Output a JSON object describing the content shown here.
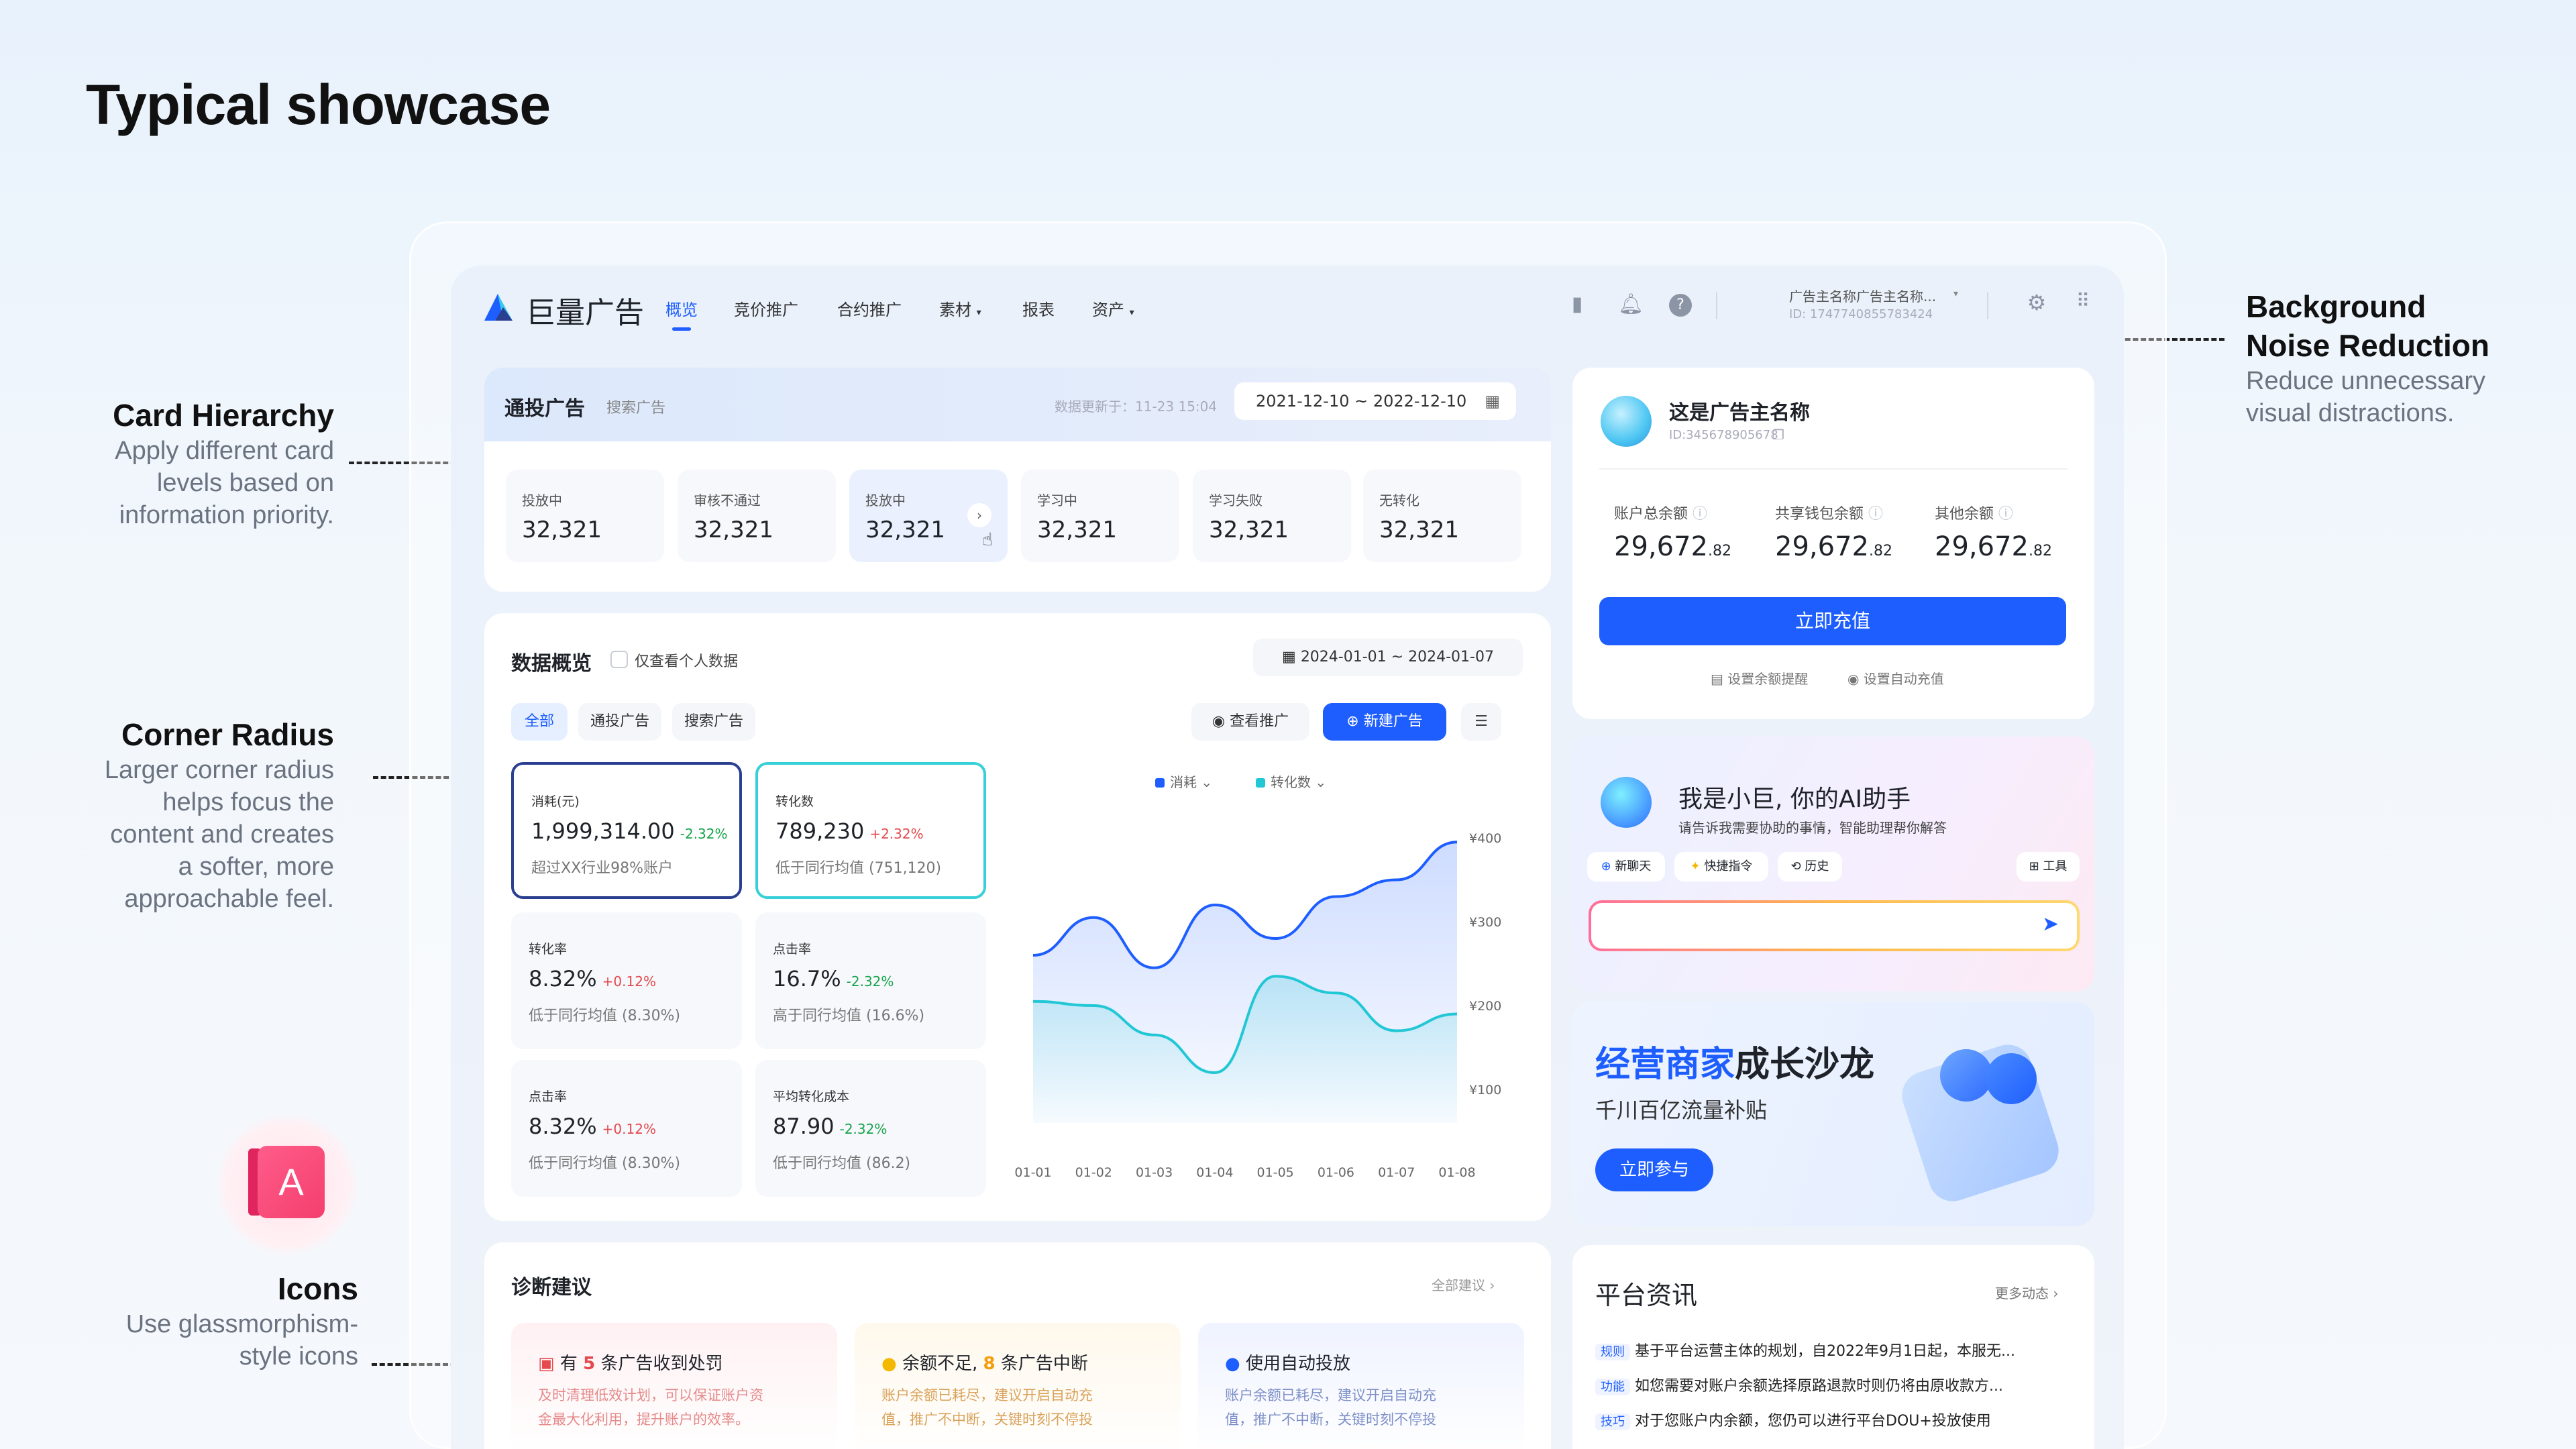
{
  "showcase": {
    "title": "Typical showcase",
    "annotations": [
      {
        "title": "Card Hierarchy",
        "desc": [
          "Apply different card",
          "levels based on",
          "information priority."
        ]
      },
      {
        "title": "Corner Radius",
        "desc": [
          "Larger corner radius",
          "helps focus the",
          "content and creates",
          "a softer, more",
          "approachable feel."
        ]
      },
      {
        "title": "Icons",
        "desc": [
          "Use glassmorphism-",
          "style icons"
        ]
      },
      {
        "title": "Background",
        "title2": "Noise Reduction",
        "desc": [
          "Reduce unnecessary",
          "visual distractions."
        ]
      }
    ]
  },
  "nav": {
    "brand": "巨量广告",
    "items": [
      "概览",
      "竞价推广",
      "合约推广",
      "素材",
      "报表",
      "资产"
    ],
    "account_name": "广告主名称广告主名称...",
    "account_id": "ID: 1747740855783424"
  },
  "topcard": {
    "tab_main": "通投广告",
    "tab_sub": "搜索广告",
    "updated": "数据更新于：11-23 15:04",
    "date_range": "2021-12-10 ~ 2022-12-10",
    "stats": [
      {
        "label": "投放中",
        "value": "32,321"
      },
      {
        "label": "审核不通过",
        "value": "32,321"
      },
      {
        "label": "投放中",
        "value": "32,321"
      },
      {
        "label": "学习中",
        "value": "32,321"
      },
      {
        "label": "学习失败",
        "value": "32,321"
      },
      {
        "label": "无转化",
        "value": "32,321"
      }
    ]
  },
  "overview": {
    "title": "数据概览",
    "only_mine": "仅查看个人数据",
    "date_range": "2024-01-01 ~ 2024-01-07",
    "filters": [
      "全部",
      "通投广告",
      "搜索广告"
    ],
    "view_btn": "查看推广",
    "new_btn": "新建广告",
    "metrics": [
      {
        "label": "消耗(元)",
        "value": "1,999,314.00",
        "delta": "-2.32%",
        "dir": "dn",
        "sub": "超过XX行业98%账户"
      },
      {
        "label": "转化数",
        "value": "789,230",
        "delta": "+2.32%",
        "dir": "up",
        "sub": "低于同行均值 (751,120)"
      },
      {
        "label": "转化率",
        "value": "8.32%",
        "delta": "+0.12%",
        "dir": "up",
        "sub": "低于同行均值 (8.30%)"
      },
      {
        "label": "点击率",
        "value": "16.7%",
        "delta": "-2.32%",
        "dir": "dn",
        "sub": "高于同行均值 (16.6%)"
      },
      {
        "label": "点击率",
        "value": "8.32%",
        "delta": "+0.12%",
        "dir": "up",
        "sub": "低于同行均值 (8.30%)"
      },
      {
        "label": "平均转化成本",
        "value": "87.90",
        "delta": "-2.32%",
        "dir": "dn",
        "sub": "低于同行均值 (86.2)"
      }
    ]
  },
  "chart_data": {
    "type": "area",
    "x": [
      "01-01",
      "01-02",
      "01-03",
      "01-04",
      "01-05",
      "01-06",
      "01-07",
      "01-08"
    ],
    "yticks": [
      "¥400",
      "¥300",
      "¥200",
      "¥100"
    ],
    "ylim": [
      60,
      420
    ],
    "legend": "top-center",
    "grid": false,
    "series": [
      {
        "name": "消耗",
        "color": "#1e5eff",
        "values": [
          260,
          305,
          245,
          320,
          280,
          330,
          350,
          395
        ]
      },
      {
        "name": "转化数",
        "color": "#22c7d5",
        "values": [
          205,
          200,
          165,
          120,
          235,
          215,
          170,
          190
        ]
      }
    ]
  },
  "account": {
    "name": "这是广告主名称",
    "id": "ID:345678905678",
    "balances": [
      {
        "label": "账户总余额",
        "int": "29,672",
        "dec": ".82"
      },
      {
        "label": "共享钱包余额",
        "int": "29,672",
        "dec": ".82"
      },
      {
        "label": "其他余额",
        "int": "29,672",
        "dec": ".82"
      }
    ],
    "recharge": "立即充值",
    "link1": "设置余额提醒",
    "link2": "设置自动充值"
  },
  "assistant": {
    "title": "我是小巨, 你的AI助手",
    "sub": "请告诉我需要协助的事情，智能助理帮你解答",
    "chips": [
      "新聊天",
      "快捷指令",
      "历史"
    ],
    "tool": "工具"
  },
  "banner": {
    "title_blue": "经营商家",
    "title_dark": "成长沙龙",
    "sub": "千川百亿流量补贴",
    "btn": "立即参与"
  },
  "diagnosis": {
    "title": "诊断建议",
    "more": "全部建议",
    "cards": [
      {
        "pre": "有",
        "num": "5",
        "post": "条广告收到处罚",
        "desc": [
          "及时清理低效计划，可以保证账户资",
          "金最大化利用，提升账户的效率。"
        ]
      },
      {
        "pre": "余额不足,",
        "num": "8",
        "post": "条广告中断",
        "desc": [
          "账户余额已耗尽，建议开启自动充",
          "值，推广不中断，关键时刻不停投"
        ]
      },
      {
        "pre": "使用自动投放",
        "num": "",
        "post": "",
        "desc": [
          "账户余额已耗尽，建议开启自动充",
          "值，推广不中断，关键时刻不停投"
        ]
      }
    ]
  },
  "news": {
    "title": "平台资讯",
    "more": "更多动态",
    "items": [
      {
        "tag": "规则",
        "text": "基于平台运营主体的规划，自2022年9月1日起，本服无..."
      },
      {
        "tag": "功能",
        "text": "如您需要对账户余额选择原路退款时则仍将由原收款方..."
      },
      {
        "tag": "技巧",
        "text": "对于您账户内余额，您仍可以进行平台DOU+投放使用"
      }
    ]
  }
}
